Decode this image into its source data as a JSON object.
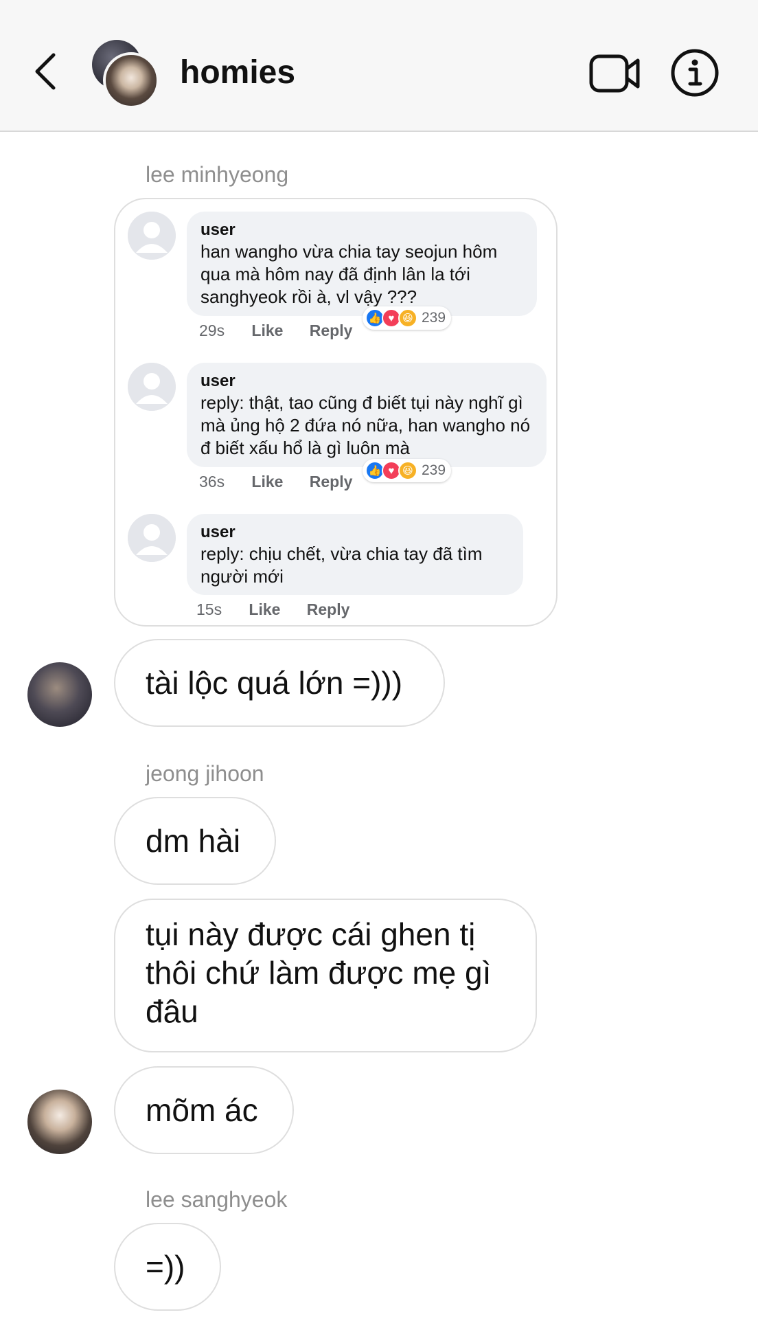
{
  "header": {
    "title": "homies",
    "icons": {
      "back": "chevron-left-icon",
      "video": "video-camera-icon",
      "info": "info-icon"
    }
  },
  "messages": {
    "sender1": "lee minhyeong",
    "shared_post": {
      "comments": [
        {
          "user": "user",
          "text": "han wangho vừa chia tay seojun hôm qua mà hôm nay đã định lân la tới sanghyeok rồi à, vl vậy ???",
          "time": "29s",
          "like": "Like",
          "reply": "Reply",
          "reaction_count": "239"
        },
        {
          "user": "user",
          "text": "reply: thật, tao cũng đ biết tụi này nghĩ gì mà ủng hộ 2 đứa nó nữa, han wangho nó đ biết xấu hổ là gì luôn mà",
          "time": "36s",
          "like": "Like",
          "reply": "Reply",
          "reaction_count": "239"
        },
        {
          "user": "user",
          "text": "reply: chịu chết, vừa chia tay đã tìm người mới",
          "time": "15s",
          "like": "Like",
          "reply": "Reply"
        }
      ]
    },
    "msg1": "tài lộc quá lớn =)))",
    "sender2": "jeong jihoon",
    "msg2": "dm hài",
    "msg3": "tụi này được cái ghen tị thôi chứ làm được mẹ gì đâu",
    "msg4": "mõm ác",
    "sender3": "lee sanghyeok",
    "msg5": "=))"
  }
}
